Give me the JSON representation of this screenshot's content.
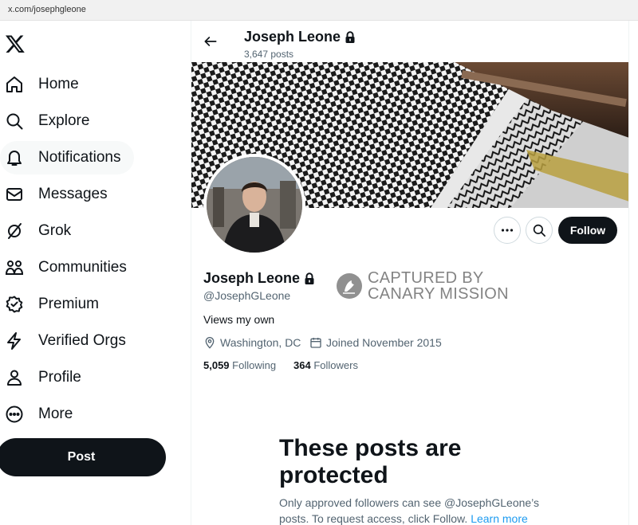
{
  "browser": {
    "url": "x.com/josephgleone"
  },
  "sidebar": {
    "logo_icon": "x-logo-icon",
    "items": [
      {
        "label": "Home",
        "icon": "home-icon"
      },
      {
        "label": "Explore",
        "icon": "search-icon"
      },
      {
        "label": "Notifications",
        "icon": "bell-icon"
      },
      {
        "label": "Messages",
        "icon": "envelope-icon"
      },
      {
        "label": "Grok",
        "icon": "grok-icon"
      },
      {
        "label": "Communities",
        "icon": "people-icon"
      },
      {
        "label": "Premium",
        "icon": "verified-badge-icon"
      },
      {
        "label": "Verified Orgs",
        "icon": "lightning-icon"
      },
      {
        "label": "Profile",
        "icon": "person-icon"
      },
      {
        "label": "More",
        "icon": "more-circle-icon"
      }
    ],
    "post_label": "Post"
  },
  "header": {
    "name": "Joseph Leone",
    "post_count": "3,647 posts"
  },
  "profile": {
    "name": "Joseph Leone",
    "handle": "@JosephGLeone",
    "bio": "Views my own",
    "location": "Washington, DC",
    "joined": "Joined November 2015",
    "following_count": "5,059",
    "following_label": "Following",
    "followers_count": "364",
    "followers_label": "Followers",
    "follow_label": "Follow"
  },
  "watermark": {
    "line1": "CAPTURED BY",
    "line2": "CANARY MISSION"
  },
  "protected": {
    "title": "These posts are protected",
    "body": "Only approved followers can see @JosephGLeone’s posts. To request access, click Follow.",
    "link": "Learn more"
  },
  "colors": {
    "accent": "#1d9bf0",
    "text": "#0f1419",
    "muted": "#536471",
    "button_dark": "#0f1419"
  }
}
